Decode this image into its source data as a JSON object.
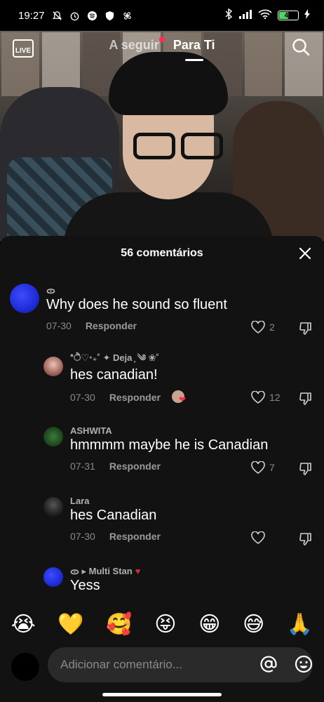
{
  "status_bar": {
    "time": "19:27",
    "battery": "47"
  },
  "top_nav": {
    "live_label": "LIVE",
    "tab_following": "A seguir",
    "tab_foryou": "Para Ti"
  },
  "comments_sheet": {
    "title": "56 comentários",
    "reply_label": "Responder",
    "comments": [
      {
        "username": "ᯣ",
        "text": "Why does he sound so fluent",
        "date": "07-30",
        "likes": "2",
        "avatar_color": "#1f2bd6"
      },
      {
        "username": "*ੈ♡‧₊˚ ✦ Deja ̥ ༄ ❀˚",
        "text": "hes canadian!",
        "date": "07-30",
        "likes": "12",
        "avatar_color": "#a86b62",
        "creator_liked": true
      },
      {
        "username": "ASHWITA",
        "text": "hmmmm maybe he is Canadian",
        "date": "07-31",
        "likes": "7",
        "avatar_color": "#1e4a1e"
      },
      {
        "username": "Lara",
        "text": "hes Canadian",
        "date": "07-30",
        "likes": "",
        "avatar_color": "#2a2a2a"
      },
      {
        "username": "ᯣ ▸ Multi Stan",
        "text": "Yess",
        "avatar_color": "#1f2bd6"
      }
    ]
  },
  "emoji_bar": [
    "😭",
    "💛",
    "🥰",
    "😝",
    "😁",
    "😅",
    "🙏"
  ],
  "input": {
    "placeholder": "Adicionar comentário..."
  }
}
